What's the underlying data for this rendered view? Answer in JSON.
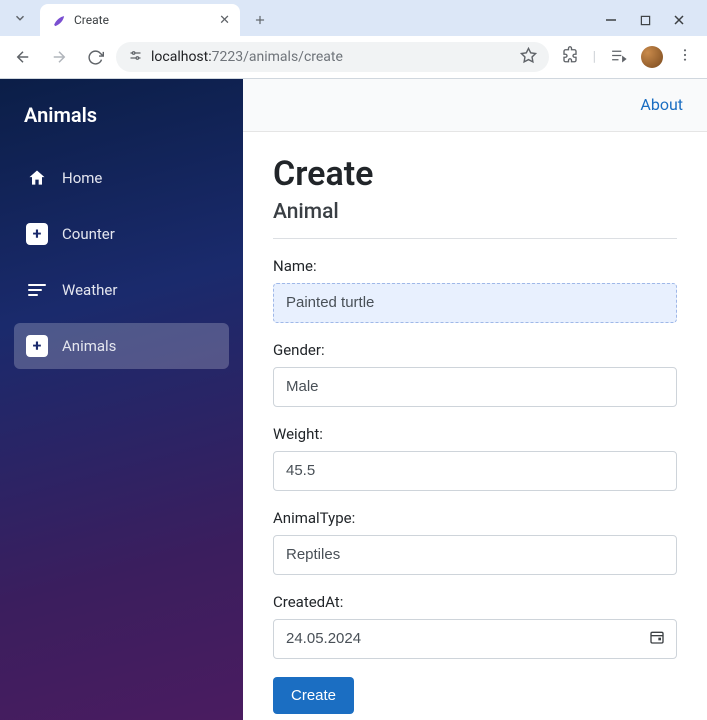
{
  "browser": {
    "tab_title": "Create",
    "url_host": "localhost:",
    "url_port_path": "7223/animals/create"
  },
  "sidebar": {
    "brand": "Animals",
    "items": [
      {
        "label": "Home"
      },
      {
        "label": "Counter"
      },
      {
        "label": "Weather"
      },
      {
        "label": "Animals"
      }
    ]
  },
  "topbar": {
    "about": "About"
  },
  "page": {
    "title": "Create",
    "subtitle": "Animal"
  },
  "form": {
    "name_label": "Name:",
    "name_value": "Painted turtle",
    "gender_label": "Gender:",
    "gender_value": "Male",
    "weight_label": "Weight:",
    "weight_value": "45.5",
    "type_label": "AnimalType:",
    "type_value": "Reptiles",
    "created_label": "CreatedAt:",
    "created_value": "24.05.2024",
    "submit_label": "Create"
  }
}
